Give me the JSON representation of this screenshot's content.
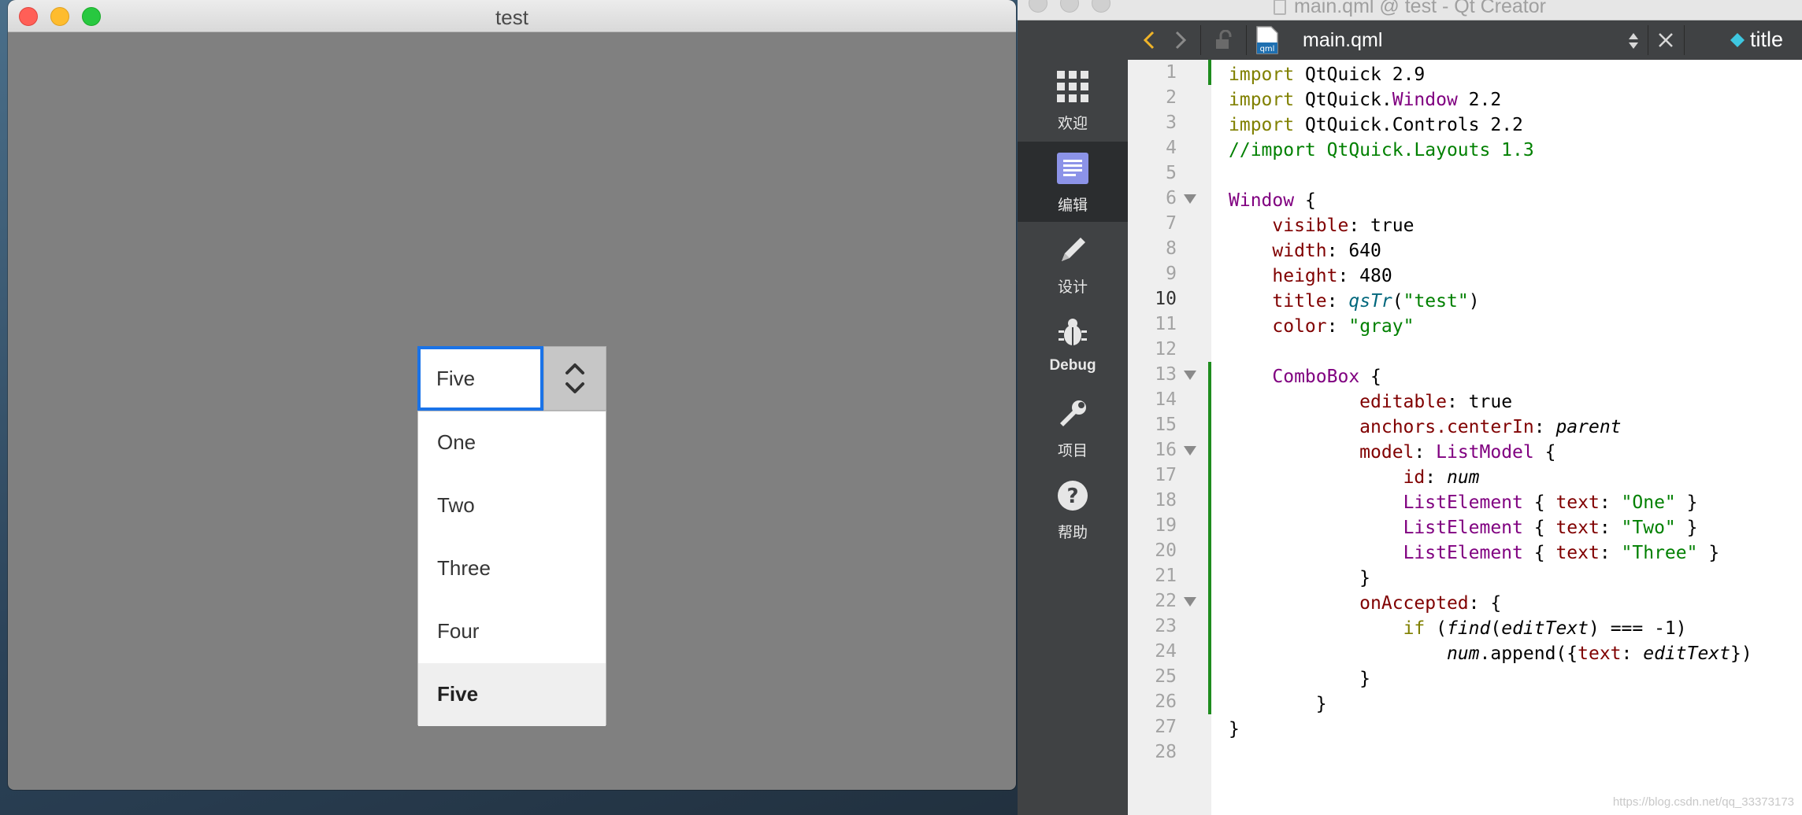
{
  "app_window": {
    "title": "test",
    "combobox": {
      "edit_text": "Five",
      "items": [
        "One",
        "Two",
        "Three",
        "Four",
        "Five"
      ],
      "selected_index": 4
    }
  },
  "qt_creator": {
    "window_title": "main.qml @ test - Qt Creator",
    "modes": [
      {
        "label": "欢迎",
        "icon": "grid-icon"
      },
      {
        "label": "编辑",
        "icon": "document-icon"
      },
      {
        "label": "设计",
        "icon": "pencil-icon"
      },
      {
        "label": "Debug",
        "icon": "bug-icon"
      },
      {
        "label": "项目",
        "icon": "wrench-icon"
      },
      {
        "label": "帮助",
        "icon": "help-icon"
      }
    ],
    "active_mode": "编辑",
    "toolbar": {
      "file_name": "main.qml",
      "file_icon_label": "qml",
      "symbol_name": "title"
    },
    "current_line": 10,
    "code_lines": [
      "import QtQuick 2.9",
      "import QtQuick.Window 2.2",
      "import QtQuick.Controls 2.2",
      "//import QtQuick.Layouts 1.3",
      "",
      "Window {",
      "    visible: true",
      "    width: 640",
      "    height: 480",
      "    title: qsTr(\"test\")",
      "    color: \"gray\"",
      "",
      "    ComboBox {",
      "            editable: true",
      "            anchors.centerIn: parent",
      "            model: ListModel {",
      "                id: num",
      "                ListElement { text: \"One\" }",
      "                ListElement { text: \"Two\" }",
      "                ListElement { text: \"Three\" }",
      "            }",
      "            onAccepted: {",
      "                if (find(editText) === -1)",
      "                    num.append({text: editText})",
      "            }",
      "        }",
      "}",
      ""
    ],
    "watermark": "https://blog.csdn.net/qq_33373173"
  },
  "colors": {
    "keyword": "#808000",
    "comment": "#008000",
    "type": "#800080",
    "property": "#800000",
    "string": "#008000",
    "function": "#00677c",
    "focus_border": "#1a73e8",
    "change_marker": "#1e8c1e"
  }
}
